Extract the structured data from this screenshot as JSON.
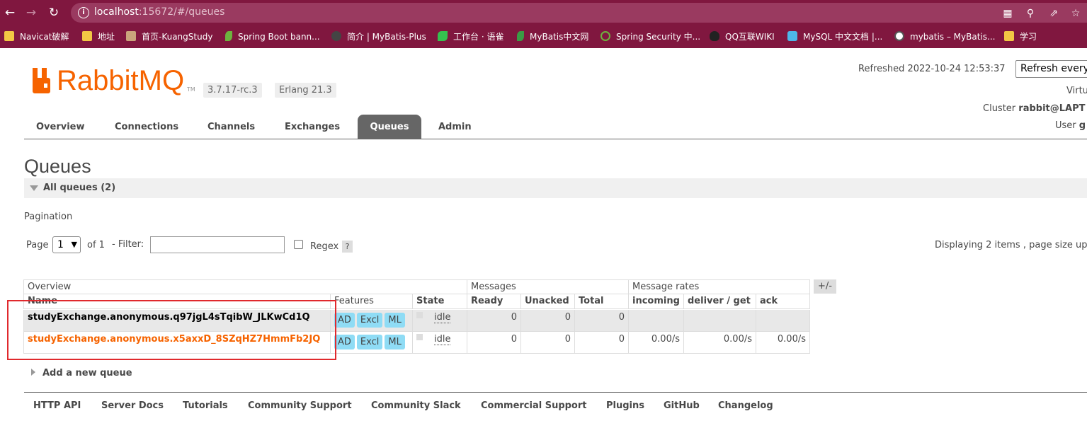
{
  "browser": {
    "url_host": "localhost",
    "url_path": ":15672/#/queues",
    "bookmarks": [
      {
        "label": "Navicat破解",
        "icon": "folder-icon"
      },
      {
        "label": "地址",
        "icon": "folder-icon"
      },
      {
        "label": "首页-KuangStudy",
        "icon": "avatar-icon"
      },
      {
        "label": "Spring Boot bann...",
        "icon": "leaf-icon"
      },
      {
        "label": "简介 | MyBatis-Plus",
        "icon": "mybatis-plus-icon"
      },
      {
        "label": "工作台 · 语雀",
        "icon": "yuque-icon"
      },
      {
        "label": "MyBatis中文网",
        "icon": "mongodb-leaf-icon"
      },
      {
        "label": "Spring Security 中...",
        "icon": "spring-icon"
      },
      {
        "label": "QQ互联WIKI",
        "icon": "qq-penguin-icon"
      },
      {
        "label": "MySQL 中文文档 |...",
        "icon": "mysql-dolphin-icon"
      },
      {
        "label": "mybatis – MyBatis...",
        "icon": "globe-icon"
      },
      {
        "label": "学习",
        "icon": "folder-icon"
      }
    ]
  },
  "header": {
    "logo_text": "RabbitMQ",
    "logo_tm": "TM",
    "version": "3.7.17-rc.3",
    "erlang": "Erlang 21.3",
    "refreshed": "Refreshed 2022-10-24 12:53:37",
    "refresh_select": "Refresh every",
    "virtual_host_label": "Virtu",
    "cluster_label": "Cluster",
    "cluster_value": "rabbit@LAPT",
    "user_label": "User",
    "user_value": "g"
  },
  "tabs": [
    {
      "label": "Overview"
    },
    {
      "label": "Connections"
    },
    {
      "label": "Channels"
    },
    {
      "label": "Exchanges"
    },
    {
      "label": "Queues",
      "active": true
    },
    {
      "label": "Admin"
    }
  ],
  "page": {
    "title": "Queues",
    "section_label": "All queues (2)",
    "pagination_label": "Pagination",
    "page_label": "Page",
    "page_value": "1",
    "of_label": "of 1",
    "filter_label": "- Filter:",
    "filter_value": "",
    "regex_label": "Regex",
    "help_label": "?",
    "displaying": "Displaying 2 items , page size up"
  },
  "table": {
    "group_headers": {
      "overview": "Overview",
      "messages": "Messages",
      "rates": "Message rates"
    },
    "columns": {
      "name": "Name",
      "features": "Features",
      "state": "State",
      "ready": "Ready",
      "unacked": "Unacked",
      "total": "Total",
      "incoming": "incoming",
      "deliver_get": "deliver / get",
      "ack": "ack"
    },
    "plus_minus": "+/-",
    "rows": [
      {
        "name": "studyExchange.anonymous.q97jgL4sTqibW_JLKwCd1Q",
        "badges": [
          "AD",
          "Excl",
          "ML"
        ],
        "state": "idle",
        "ready": "0",
        "unacked": "0",
        "total": "0",
        "incoming": "",
        "deliver_get": "",
        "ack": ""
      },
      {
        "name": "studyExchange.anonymous.x5axxD_8SZqHZ7HmmFb2JQ",
        "badges": [
          "AD",
          "Excl",
          "ML"
        ],
        "state": "idle",
        "ready": "0",
        "unacked": "0",
        "total": "0",
        "incoming": "0.00/s",
        "deliver_get": "0.00/s",
        "ack": "0.00/s"
      }
    ]
  },
  "add_queue": "Add a new queue",
  "footer_links": [
    "HTTP API",
    "Server Docs",
    "Tutorials",
    "Community Support",
    "Community Slack",
    "Commercial Support",
    "Plugins",
    "GitHub",
    "Changelog"
  ],
  "colors": {
    "chrome": "#80173f",
    "brand_orange": "#f66300",
    "badge": "#8fdcf5",
    "highlight_box": "#e0292d"
  }
}
